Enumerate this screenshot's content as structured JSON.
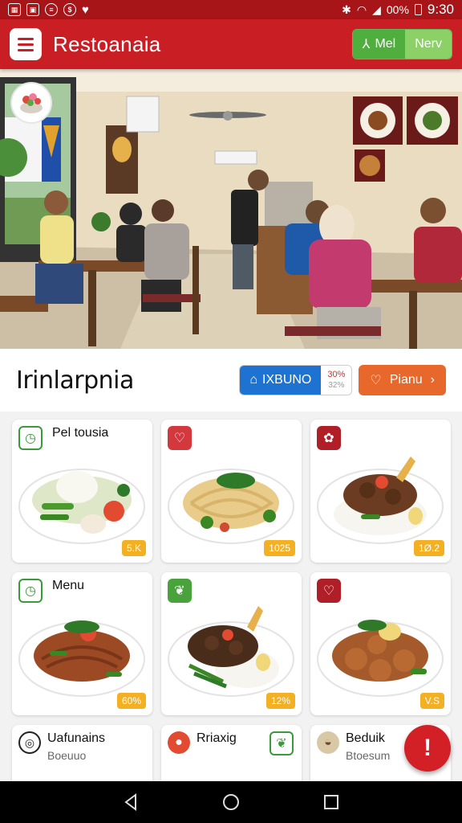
{
  "status_bar": {
    "battery": "00%",
    "time": "9:30",
    "icons": [
      "gallery-icon",
      "image-icon",
      "message-icon",
      "dollar-icon",
      "heart-icon"
    ]
  },
  "app_bar": {
    "title": "Restoanaia",
    "toggle_left": "Mel",
    "toggle_right": "Nerv"
  },
  "section": {
    "title": "Irinlarpnia",
    "blue_button": "IXBUNO",
    "pct_top": "30%",
    "pct_bottom": "32%",
    "orange_button": "Pianu"
  },
  "cards": [
    {
      "title": "Pel tousia",
      "price": "5.K",
      "tag": "clock-icon"
    },
    {
      "title": "",
      "price": "1025",
      "tag": "heart-icon"
    },
    {
      "title": "",
      "price": "1Ø.2",
      "tag": "herb-icon"
    },
    {
      "title": "Menu",
      "price": "60%",
      "tag": "clock-icon"
    },
    {
      "title": "",
      "price": "12%",
      "tag": "leaf-icon"
    },
    {
      "title": "",
      "price": "V.S",
      "tag": "heart-icon"
    },
    {
      "title": "Uafunains",
      "sub": "Boeuuo",
      "tag": "globe-icon"
    },
    {
      "title": "Rriaxig",
      "sub": "",
      "tag": "tomato-icon"
    },
    {
      "title": "Beduik",
      "sub": "Btoesum",
      "tag": "dumpling-icon"
    }
  ],
  "colors": {
    "primary": "#c81e24",
    "accent_green": "#4fae3e",
    "accent_blue": "#1e73d2",
    "accent_orange": "#e8672a",
    "price_badge": "#f2b022"
  }
}
